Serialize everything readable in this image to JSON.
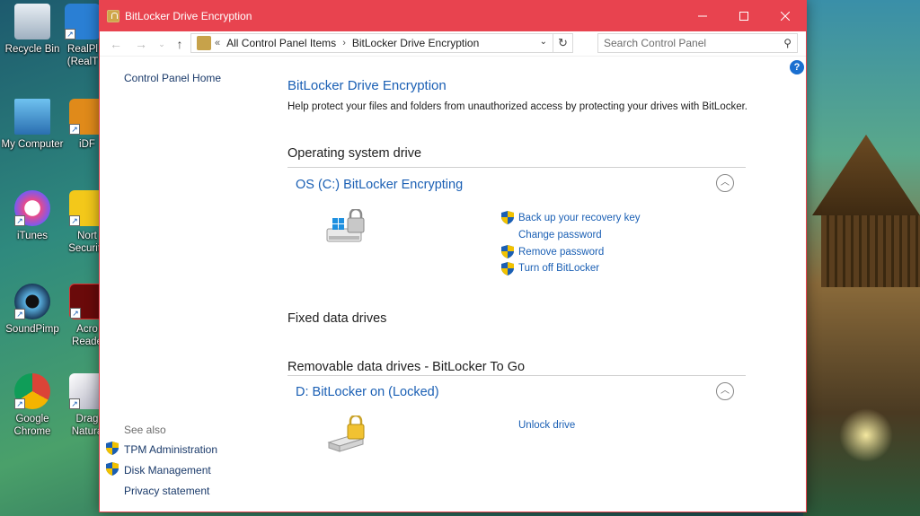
{
  "desktop": {
    "icons": [
      {
        "label": "Recycle Bin"
      },
      {
        "label": "RealPl (RealT"
      },
      {
        "label": "My Computer"
      },
      {
        "label": "iDF"
      },
      {
        "label": "iTunes"
      },
      {
        "label": "Nort Security"
      },
      {
        "label": "SoundPimp"
      },
      {
        "label": "Acro Reade"
      },
      {
        "label": "Google Chrome"
      },
      {
        "label": "Drag Natura"
      }
    ]
  },
  "window": {
    "title": "BitLocker Drive Encryption",
    "accent": "#e8434f",
    "controls": {
      "minimize": "minimize-icon",
      "maximize": "maximize-icon",
      "close": "close-icon"
    }
  },
  "address": {
    "overflow": "«",
    "crumbs": [
      "All Control Panel Items",
      "BitLocker Drive Encryption"
    ],
    "search_placeholder": "Search Control Panel"
  },
  "left_pane": {
    "home": "Control Panel Home",
    "see_also_heading": "See also",
    "links": [
      "TPM Administration",
      "Disk Management",
      "Privacy statement"
    ]
  },
  "main": {
    "title": "BitLocker Drive Encryption",
    "description": "Help protect your files and folders from unauthorized access by protecting your drives with BitLocker.",
    "os_section": "Operating system drive",
    "os_drive": {
      "title": "OS (C:) BitLocker Encrypting",
      "actions": [
        "Back up your recovery key",
        "Change password",
        "Remove password",
        "Turn off BitLocker"
      ]
    },
    "fixed_section": "Fixed data drives",
    "removable_section": "Removable data drives - BitLocker To Go",
    "removable_drive": {
      "title": "D: BitLocker on (Locked)",
      "actions": [
        "Unlock drive"
      ]
    }
  }
}
